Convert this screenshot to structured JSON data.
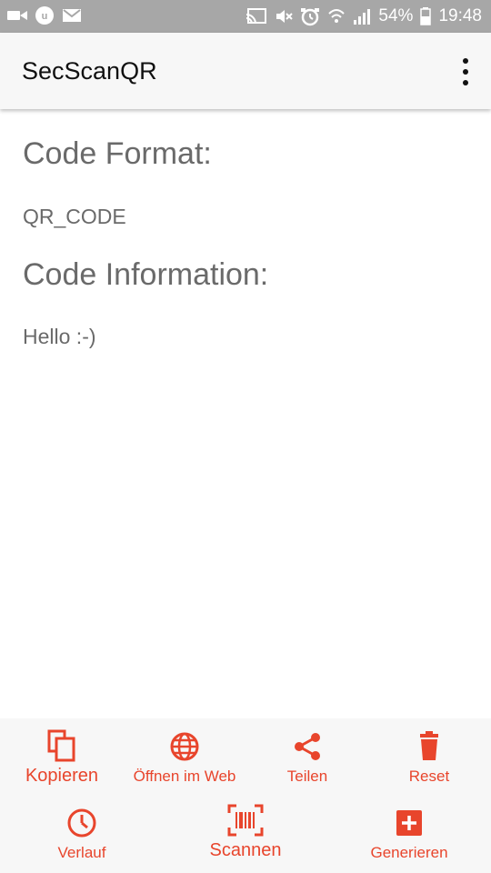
{
  "status_bar": {
    "battery": "54%",
    "time": "19:48",
    "icons_left": [
      "video-icon",
      "app-badge-icon",
      "gmail-icon"
    ],
    "icons_right": [
      "cast-icon",
      "mute-icon",
      "alarm-icon",
      "wifi-icon",
      "signal-icon",
      "battery-icon"
    ]
  },
  "app_bar": {
    "title": "SecScanQR",
    "menu_icon": "overflow-menu-icon"
  },
  "content": {
    "format_heading": "Code Format:",
    "format_value": "QR_CODE",
    "info_heading": "Code Information:",
    "info_value": "Hello :-)"
  },
  "actions": {
    "copy": "Kopieren",
    "open_web": "Öffnen im Web",
    "share": "Teilen",
    "reset": "Reset",
    "history": "Verlauf",
    "scan": "Scannen",
    "generate": "Generieren"
  },
  "colors": {
    "accent": "#e8452c",
    "status_bar": "#a7a7a7",
    "app_bar": "#f7f7f7",
    "text_gray": "#6a6a6a"
  }
}
